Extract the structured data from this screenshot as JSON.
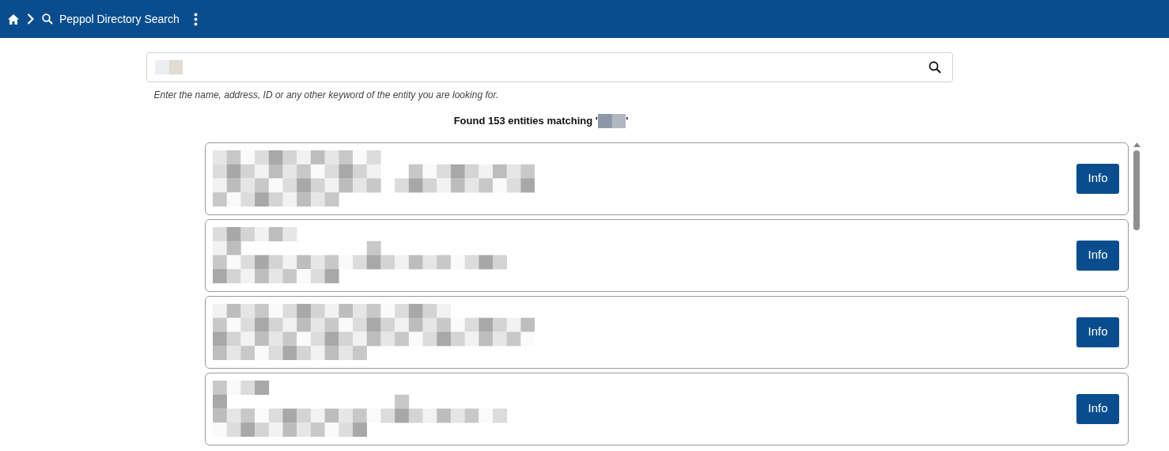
{
  "header": {
    "title": "Peppol Directory Search"
  },
  "search": {
    "hint": "Enter the name, address, ID or any other keyword of the entity you are looking for."
  },
  "summary": {
    "prefix": "Found 153 entities matching '",
    "suffix": "'"
  },
  "results": [
    {
      "button": "Info"
    },
    {
      "button": "Info"
    },
    {
      "button": "Info"
    },
    {
      "button": "Info"
    }
  ]
}
